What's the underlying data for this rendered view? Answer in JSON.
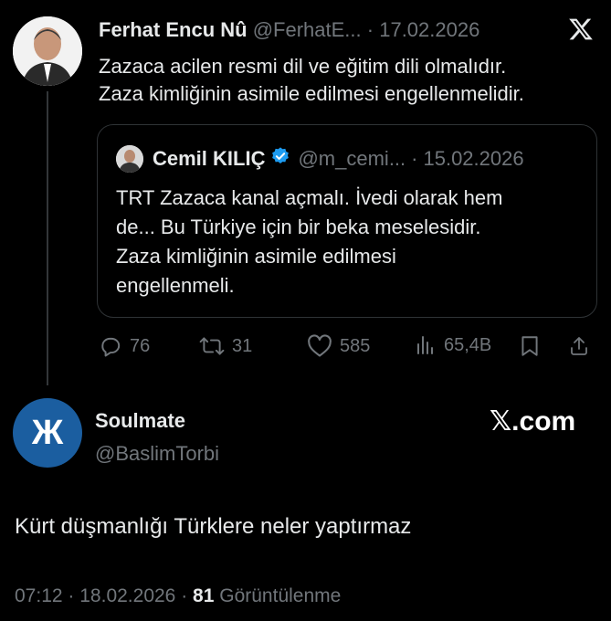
{
  "tweet": {
    "author_name": "Ferhat Encu Nû",
    "author_handle": "@FerhatE...",
    "separator": "·",
    "date": "17.02.2026",
    "text_line1": "Zazaca acilen resmi dil ve eğitim dili olmalıdır.",
    "text_line2": "Zaza kimliğinin asimile edilmesi engellenmelidir.",
    "quote": {
      "author_name": "Cemil KILIÇ",
      "author_handle": "@m_cemi...",
      "separator": "·",
      "date": "15.02.2026",
      "lines": [
        "TRT Zazaca kanal açmalı. İvedi olarak hem",
        "de... Bu Türkiye için bir beka meselesidir.",
        "Zaza kimliğinin asimile edilmesi",
        "engellenmeli."
      ]
    },
    "actions": {
      "replies": "76",
      "reposts": "31",
      "likes": "585",
      "views": "65,4B"
    }
  },
  "reply": {
    "avatar_letter": "Ж",
    "author_name": "Soulmate",
    "author_handle": "@BaslimTorbi",
    "brand": "𝕏.com",
    "text": "Kürt düşmanlığı Türklere neler yaptırmaz",
    "time": "07:12",
    "separator": "·",
    "date": "18.02.2026",
    "separator2": "·",
    "views_count": "81",
    "views_label": "Görüntülenme"
  },
  "colors": {
    "background": "#000000",
    "text": "#e7e9ea",
    "muted": "#71767b",
    "verified": "#1d9bf0",
    "avatar2": "#1b5ea0"
  }
}
